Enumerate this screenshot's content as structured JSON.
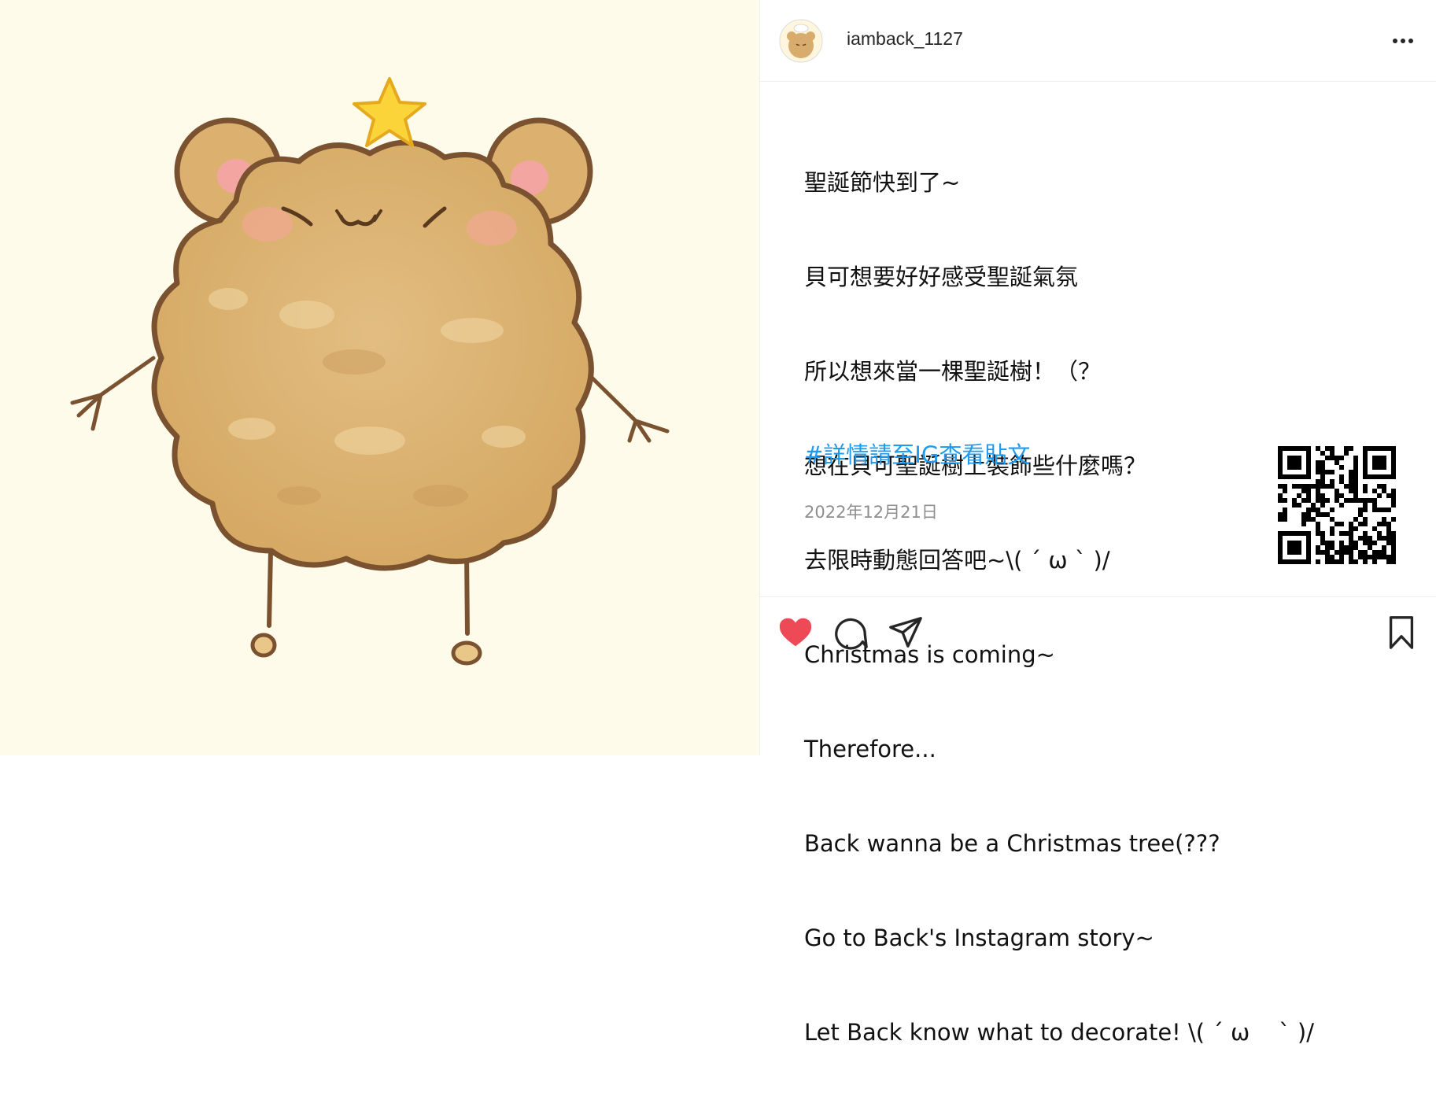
{
  "post": {
    "username": "iamback_1127",
    "caption_lines": [
      "聖誕節快到了~",
      "貝可想要好好感受聖誕氣氛",
      "所以想來當一棵聖誕樹！（？",
      "想在貝可聖誕樹上裝飾些什麼嗎？",
      "去限時動態回答吧~\\( ´ ω ` )/",
      "Christmas is coming~",
      "Therefore...",
      "Back wanna be a Christmas tree(???",
      "Go to Back's Instagram story~",
      "Let Back know what to decorate! \\( ´ ω    ` )/"
    ],
    "hashtag": "#詳情請至IG查看貼文",
    "date": "2022年12月21日",
    "liked": true
  },
  "icons": {
    "more": "more-options-icon",
    "like": "heart-icon",
    "comment": "comment-icon",
    "share": "share-icon",
    "save": "bookmark-icon"
  },
  "colors": {
    "like": "#ed4956",
    "hashtag": "#1d9bf0",
    "date": "#8e8e8e",
    "media_bg": "#fefbeb"
  }
}
